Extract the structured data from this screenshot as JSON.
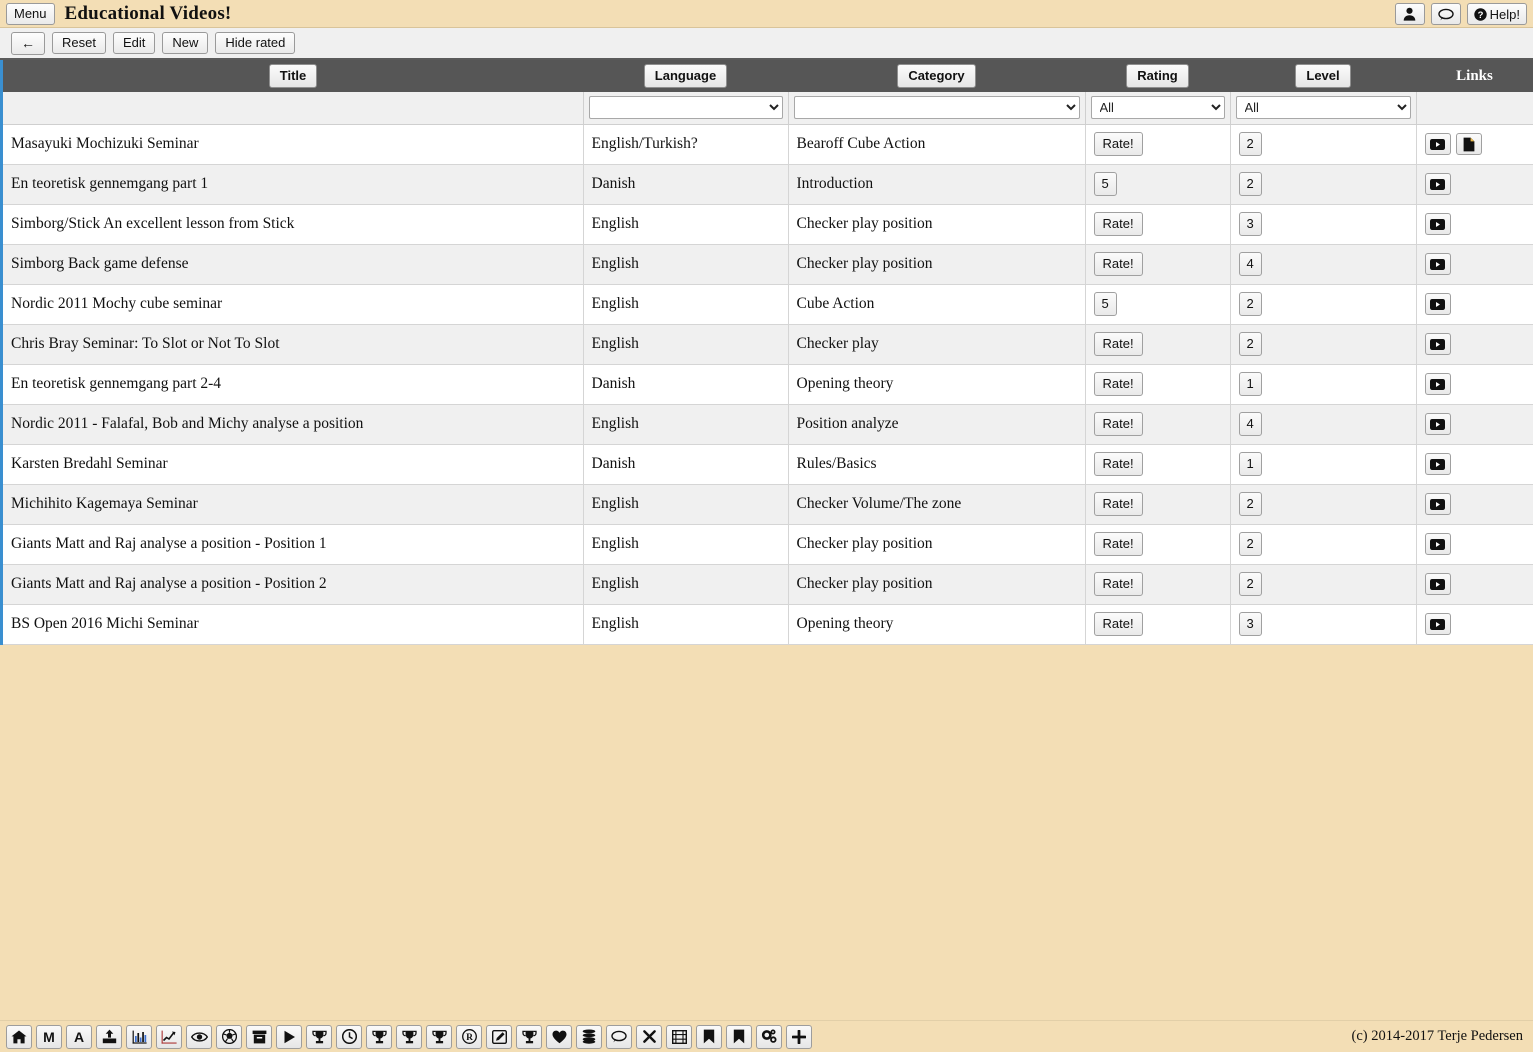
{
  "titlebar": {
    "menu_label": "Menu",
    "app_title": "Educational Videos!",
    "user_icon": "user-icon",
    "chat_icon": "chat-bubble-icon",
    "help_label": "Help!"
  },
  "toolbar": {
    "back_label": "←",
    "reset_label": "Reset",
    "edit_label": "Edit",
    "new_label": "New",
    "hide_rated_label": "Hide rated"
  },
  "table": {
    "headers": [
      {
        "label": "Title",
        "type": "button"
      },
      {
        "label": "Language",
        "type": "button"
      },
      {
        "label": "Category",
        "type": "button"
      },
      {
        "label": "Rating",
        "type": "button"
      },
      {
        "label": "Level",
        "type": "button"
      },
      {
        "label": "Links",
        "type": "text"
      }
    ],
    "filters": {
      "title": {
        "value": "",
        "type": "none"
      },
      "language": {
        "value": "",
        "options": [
          "",
          "English",
          "Danish",
          "English/Turkish?"
        ]
      },
      "category": {
        "value": "",
        "options": [
          "",
          "Bearoff Cube Action",
          "Introduction",
          "Checker play position",
          "Cube Action",
          "Checker play",
          "Opening theory",
          "Position analyze",
          "Rules/Basics",
          "Checker Volume/The zone"
        ]
      },
      "rating": {
        "value": "All",
        "options": [
          "All",
          "1",
          "2",
          "3",
          "4",
          "5"
        ]
      },
      "level": {
        "value": "All",
        "options": [
          "All",
          "1",
          "2",
          "3",
          "4"
        ]
      }
    },
    "rows": [
      {
        "title": "Masayuki Mochizuki Seminar",
        "language": "English/Turkish?",
        "category": "Bearoff Cube Action",
        "rating": "Rate!",
        "rating_is_value": false,
        "level": "2",
        "links": [
          "video-icon",
          "document-icon"
        ]
      },
      {
        "title": "En teoretisk gennemgang part 1",
        "language": "Danish",
        "category": "Introduction",
        "rating": "5",
        "rating_is_value": true,
        "level": "2",
        "links": [
          "video-icon"
        ]
      },
      {
        "title": "Simborg/Stick An excellent lesson from Stick",
        "language": "English",
        "category": "Checker play position",
        "rating": "Rate!",
        "rating_is_value": false,
        "level": "3",
        "links": [
          "video-icon"
        ]
      },
      {
        "title": "Simborg Back game defense",
        "language": "English",
        "category": "Checker play position",
        "rating": "Rate!",
        "rating_is_value": false,
        "level": "4",
        "links": [
          "video-icon"
        ]
      },
      {
        "title": "Nordic 2011 Mochy cube seminar",
        "language": "English",
        "category": "Cube Action",
        "rating": "5",
        "rating_is_value": true,
        "level": "2",
        "links": [
          "video-icon"
        ]
      },
      {
        "title": "Chris Bray Seminar: To Slot or Not To Slot",
        "language": "English",
        "category": "Checker play",
        "rating": "Rate!",
        "rating_is_value": false,
        "level": "2",
        "links": [
          "video-icon"
        ]
      },
      {
        "title": "En teoretisk gennemgang part 2-4",
        "language": "Danish",
        "category": "Opening theory",
        "rating": "Rate!",
        "rating_is_value": false,
        "level": "1",
        "links": [
          "video-icon"
        ]
      },
      {
        "title": "Nordic 2011 - Falafal, Bob and Michy analyse a position",
        "language": "English",
        "category": "Position analyze",
        "rating": "Rate!",
        "rating_is_value": false,
        "level": "4",
        "links": [
          "video-icon"
        ]
      },
      {
        "title": "Karsten Bredahl Seminar",
        "language": "Danish",
        "category": "Rules/Basics",
        "rating": "Rate!",
        "rating_is_value": false,
        "level": "1",
        "links": [
          "video-icon"
        ]
      },
      {
        "title": "Michihito Kagemaya Seminar",
        "language": "English",
        "category": "Checker Volume/The zone",
        "rating": "Rate!",
        "rating_is_value": false,
        "level": "2",
        "links": [
          "video-icon"
        ]
      },
      {
        "title": "Giants Matt and Raj analyse a position - Position 1",
        "language": "English",
        "category": "Checker play position",
        "rating": "Rate!",
        "rating_is_value": false,
        "level": "2",
        "links": [
          "video-icon"
        ]
      },
      {
        "title": "Giants Matt and Raj analyse a position - Position 2",
        "language": "English",
        "category": "Checker play position",
        "rating": "Rate!",
        "rating_is_value": false,
        "level": "2",
        "links": [
          "video-icon"
        ]
      },
      {
        "title": "BS Open 2016 Michi Seminar",
        "language": "English",
        "category": "Opening theory",
        "rating": "Rate!",
        "rating_is_value": false,
        "level": "3",
        "links": [
          "video-icon"
        ]
      }
    ]
  },
  "footer": {
    "icons": [
      "home-icon",
      "letter-m-icon",
      "letter-a-icon",
      "upload-icon",
      "bar-chart-icon",
      "line-chart-icon",
      "eye-icon",
      "soccer-ball-icon",
      "archive-box-icon",
      "play-icon",
      "trophy-icon",
      "clock-icon",
      "trophy-icon",
      "trophy-icon",
      "trophy-icon",
      "registered-icon",
      "edit-pencil-icon",
      "trophy-icon",
      "heart-icon",
      "database-icon",
      "chat-bubble-icon",
      "close-x-icon",
      "film-icon",
      "bookmark-icon",
      "bookmark-icon",
      "gears-icon",
      "plus-icon"
    ],
    "copyright": "(c) 2014-2017 Terje Pedersen"
  },
  "colors": {
    "page_background": "#f3deb5",
    "header_bar": "#565656",
    "accent_border": "#3a8fd0",
    "row_alt": "#f0f0f0"
  }
}
